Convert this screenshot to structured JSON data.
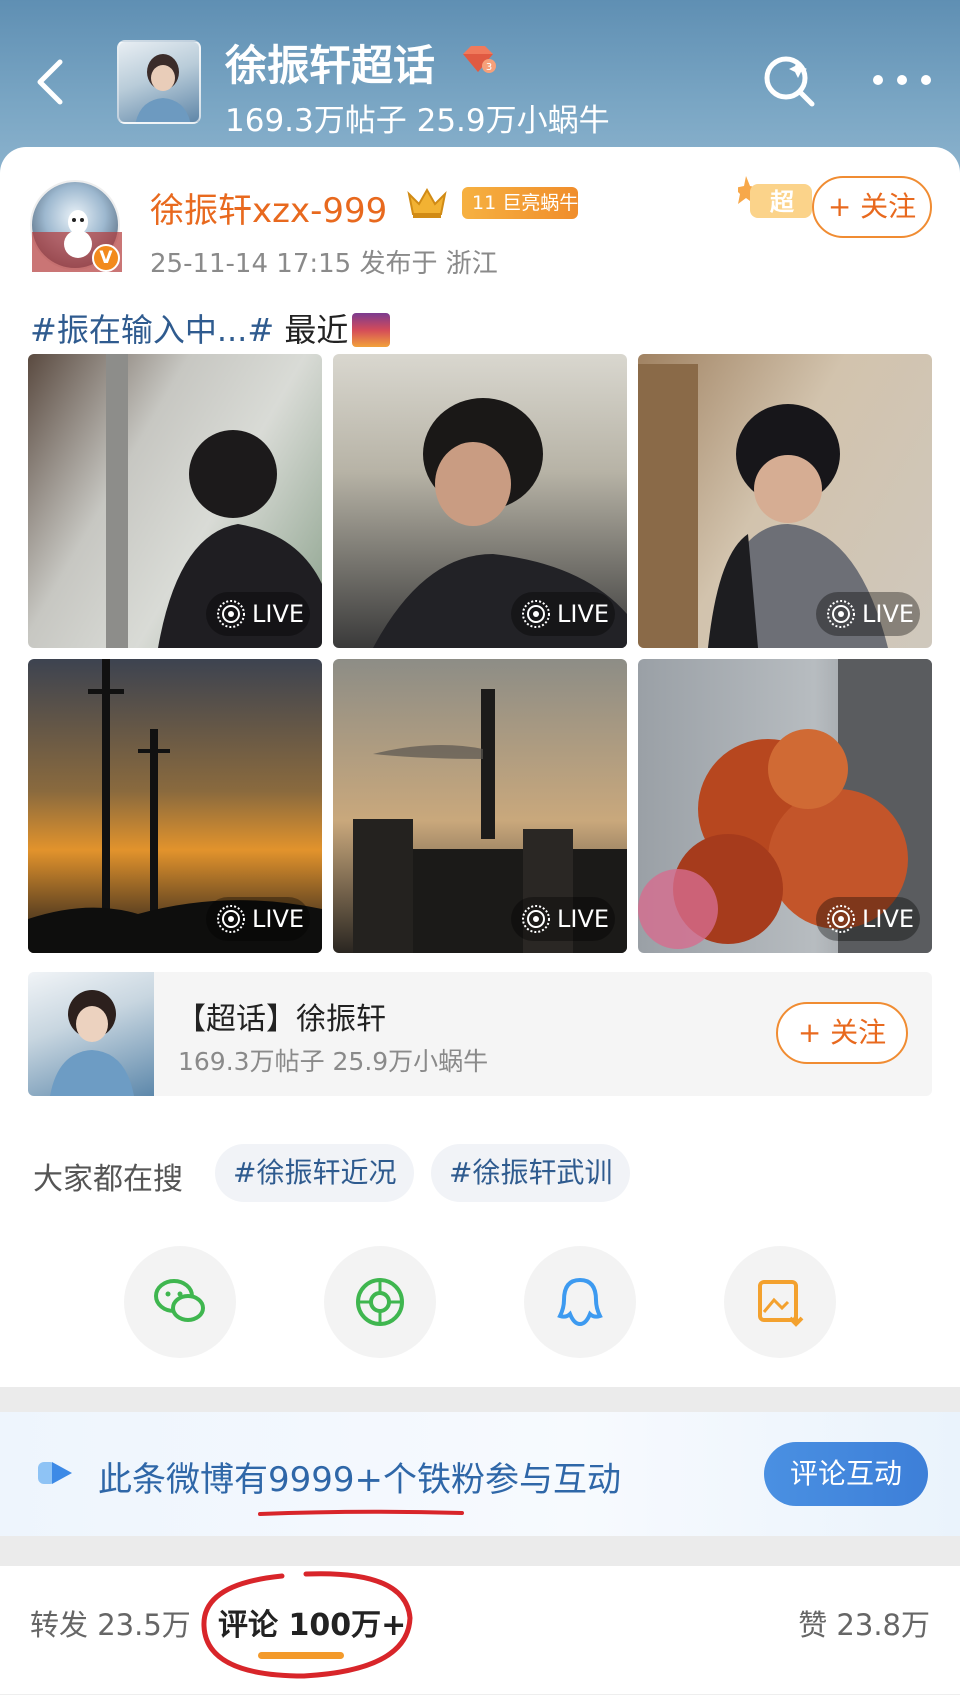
{
  "header": {
    "title": "徐振轩超话",
    "level_badge": "3",
    "stats": "169.3万帖子 25.9万小蜗牛"
  },
  "post": {
    "author": "徐振轩xzx-999",
    "verified_badge": "V",
    "member_badge": "11 巨亮蜗牛",
    "super_tag": "超",
    "follow_label": "+ 关注",
    "time_location": "25-11-14 17:15  发布于 浙江",
    "text_tag": "#振在输入中...#",
    "text_rest": " 最近",
    "live_label": "LIVE"
  },
  "topic_card": {
    "title": "【超话】徐振轩",
    "stats": "169.3万帖子 25.9万小蜗牛",
    "follow_label": "+ 关注"
  },
  "search": {
    "label": "大家都在搜",
    "tags": [
      "#徐振轩近况",
      "#徐振轩武训"
    ]
  },
  "share": {
    "icons": [
      "wechat-icon",
      "moments-icon",
      "qq-icon",
      "save-image-icon"
    ]
  },
  "banner": {
    "text_before": "此条微博有",
    "highlight": "9999+个铁粉",
    "text_after": "参与互动",
    "button_label": "评论互动"
  },
  "tabs": {
    "repost": "转发 23.5万",
    "comment": "评论 100万+",
    "like": "赞 23.8万"
  },
  "colors": {
    "accent_orange": "#e8691e",
    "link_blue": "#2f5b8f",
    "banner_blue": "#2f67a8",
    "annotation_red": "#d8252a"
  }
}
